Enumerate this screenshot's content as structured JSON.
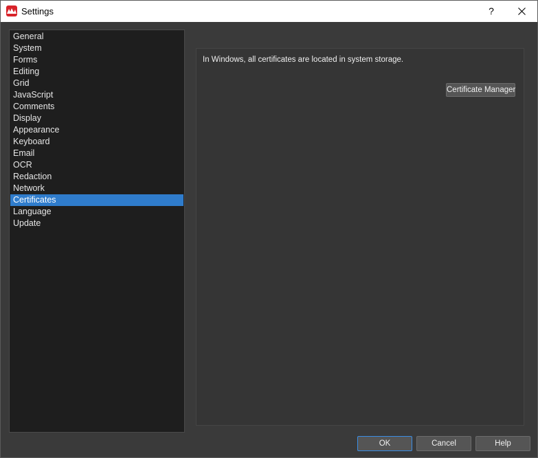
{
  "window": {
    "title": "Settings",
    "help_label": "?",
    "accent_color": "#2f7ccc"
  },
  "sidebar": {
    "items": [
      {
        "label": "General"
      },
      {
        "label": "System"
      },
      {
        "label": "Forms"
      },
      {
        "label": "Editing"
      },
      {
        "label": "Grid"
      },
      {
        "label": "JavaScript"
      },
      {
        "label": "Comments"
      },
      {
        "label": "Display"
      },
      {
        "label": "Appearance"
      },
      {
        "label": "Keyboard"
      },
      {
        "label": "Email"
      },
      {
        "label": "OCR"
      },
      {
        "label": "Redaction"
      },
      {
        "label": "Network"
      },
      {
        "label": "Certificates",
        "selected": true
      },
      {
        "label": "Language"
      },
      {
        "label": "Update"
      }
    ]
  },
  "content": {
    "info_text": "In Windows, all certificates are located in system storage.",
    "cert_manager_label": "Certificate Manager"
  },
  "footer": {
    "ok_label": "OK",
    "cancel_label": "Cancel",
    "help_label": "Help"
  },
  "icons": {
    "app": "app-logo-icon",
    "close": "close-icon"
  }
}
